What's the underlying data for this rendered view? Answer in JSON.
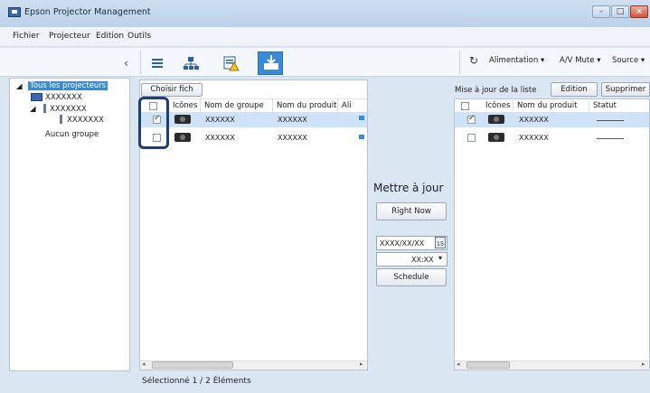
{
  "window": {
    "title": "Epson Projector Management"
  },
  "menu": [
    "Fichier",
    "Projecteur",
    "Edition",
    "Outils"
  ],
  "toolbar": {
    "power_label": "Alimentation",
    "avmute_label": "A/V Mute",
    "source_label": "Source"
  },
  "tree": {
    "root": "Tous les projecteurs",
    "item1": "XXXXXXX",
    "group1": "XXXXXXX",
    "group1_child": "XXXXXXX",
    "no_group": "Aucun groupe"
  },
  "left_panel": {
    "choose_file_label": "Choisir fich",
    "columns": [
      "Icônes",
      "Nom de groupe",
      "Nom du produit",
      "Ali"
    ],
    "rows": [
      {
        "checked": true,
        "group": "XXXXXX",
        "product": "XXXXXX"
      },
      {
        "checked": false,
        "group": "XXXXXX",
        "product": "XXXXXX"
      }
    ]
  },
  "center": {
    "heading": "Mettre à jour",
    "right_now_label": "Right Now",
    "date_value": "XXXX/XX/XX",
    "calendar_label": "15",
    "time_value": "XX:XX",
    "schedule_label": "Schedule"
  },
  "right_panel": {
    "list_title": "Mise à jour de la liste",
    "edit_label": "Edition",
    "delete_label": "Supprimer",
    "columns": [
      "Icônes",
      "Nom du produit",
      "Statut"
    ],
    "rows": [
      {
        "checked": true,
        "product": "XXXXXX"
      },
      {
        "checked": false,
        "product": "XXXXXX"
      }
    ]
  },
  "status_bar": {
    "selected_label": "Sélectionné",
    "count": "1 / 2",
    "items_label": "Éléments"
  }
}
